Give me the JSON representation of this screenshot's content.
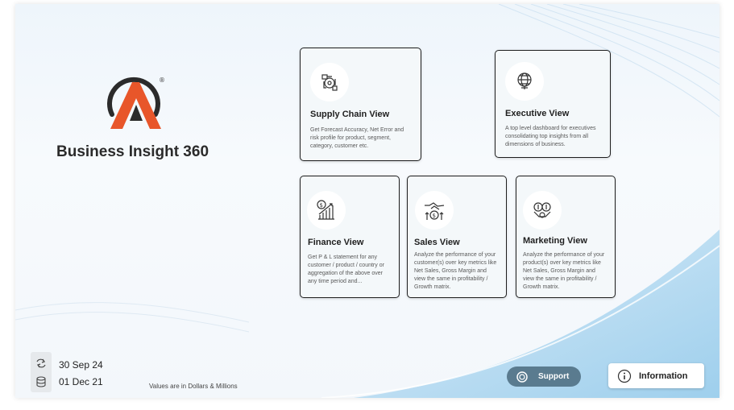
{
  "brand": {
    "title": "Business Insight 360",
    "logo_mark": "®"
  },
  "cards": {
    "supply_chain": {
      "title": "Supply Chain View",
      "description": "Get Forecast Accuracy, Net Error and risk profile for product, segment, category, customer etc.",
      "icon": "supply-chain-icon"
    },
    "executive": {
      "title": "Executive View",
      "description": "A top level dashboard for executives consolidating top insights from all dimensions of business.",
      "icon": "globe-icon"
    },
    "finance": {
      "title": "Finance View",
      "description": "Get P & L statement for any customer / product / country or aggregation of the above over any time period and...",
      "icon": "finance-chart-icon"
    },
    "sales": {
      "title": "Sales View",
      "description": "Analyze the performance of your customer(s) over key metrics like Net Sales, Gross Margin and view the same in profitability / Growth matrix.",
      "icon": "handshake-icon"
    },
    "marketing": {
      "title": "Marketing View",
      "description": "Analyze the performance of your product(s) over key metrics like Net Sales, Gross Margin and view the same in profitability / Growth matrix.",
      "icon": "marketing-icon"
    }
  },
  "dates": {
    "refresh_date": "30 Sep 24",
    "data_start": "01 Dec 21"
  },
  "note": "Values are in Dollars & Millions",
  "buttons": {
    "support": "Support",
    "information": "Information"
  },
  "colors": {
    "accent_orange": "#e8562a",
    "logo_dark": "#2b2b2b",
    "support_button": "#5a7b8f"
  }
}
